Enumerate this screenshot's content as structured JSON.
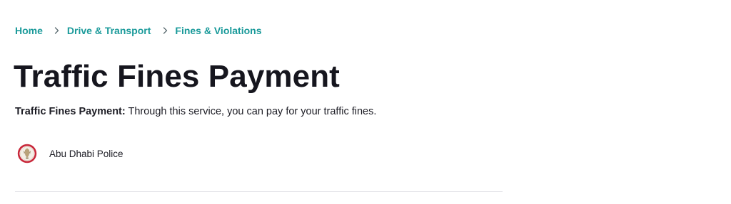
{
  "breadcrumb": {
    "items": [
      {
        "label": "Home"
      },
      {
        "label": "Drive & Transport"
      },
      {
        "label": "Fines & Violations"
      }
    ]
  },
  "page": {
    "title": "Traffic Fines Payment",
    "description_label": "Traffic Fines Payment:",
    "description_text": " Through this service, you can pay for your traffic fines."
  },
  "provider": {
    "name": "Abu Dhabi Police",
    "logo_icon": "police-emblem-icon"
  },
  "colors": {
    "link": "#1a9a9a",
    "text": "#1c1c24",
    "divider": "#e6e6ea",
    "emblem_ring": "#c8283a"
  }
}
